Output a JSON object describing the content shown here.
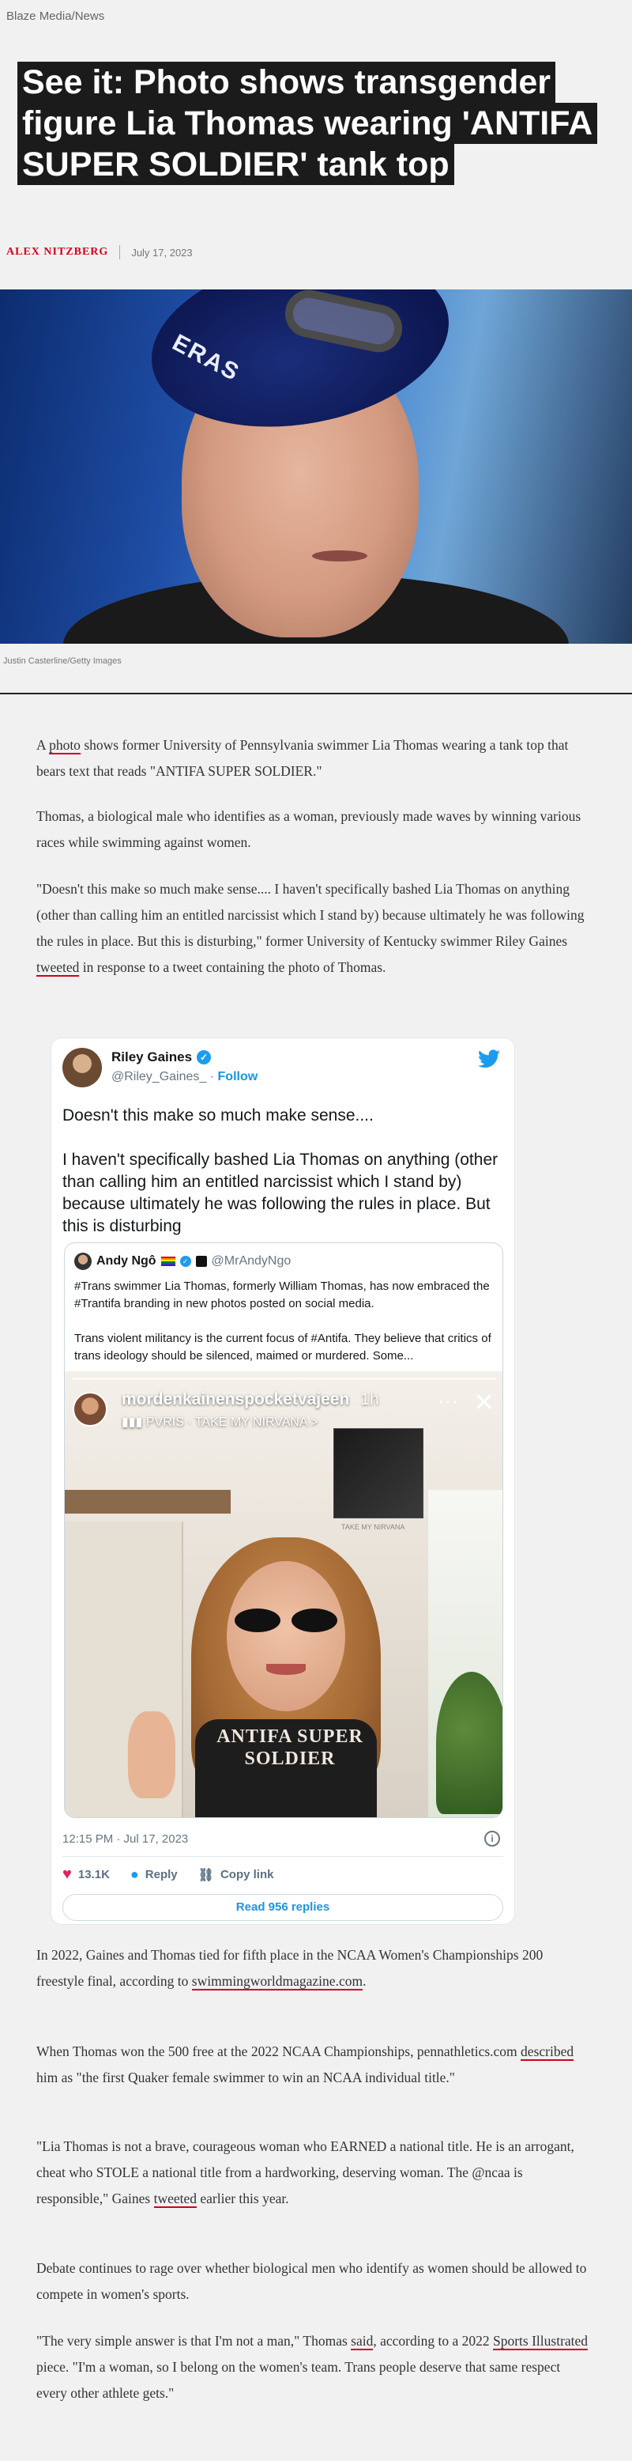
{
  "source": "Blaze Media/News",
  "headline": {
    "lines": [
      "See it: Photo shows transgender",
      "figure Lia Thomas wearing 'ANTIFA",
      "SUPER SOLDIER' tank top"
    ]
  },
  "byline": {
    "author": "Alex Nitzberg",
    "date": "July 17, 2023"
  },
  "hero": {
    "caption": "Justin Casterline/Getty Images",
    "cap_text": "ERAS"
  },
  "article": {
    "p1": {
      "link": "photo",
      "text": " shows former University of Pennsylvania swimmer Lia Thomas wearing a tank top that bears text that reads \"ANTIFA SUPER SOLDIER.\"",
      "pre": "A "
    },
    "p2": "Thomas, a biological male who identifies as a woman, previously made waves by winning various races while swimming against women.",
    "p3": {
      "pre": "\"Doesn't this make so much make sense.... I haven't specifically bashed Lia Thomas on anything (other than calling him an entitled narcissist which I stand by) because ultimately he was following the rules in place. But this is disturbing,\" former University of Kentucky swimmer Riley Gaines ",
      "link": "tweeted",
      "post": " in response to a tweet containing the photo of Thomas."
    },
    "p4": {
      "pre": "In 2022, Gaines and Thomas tied for fifth place in the NCAA Women's Championships 200 freestyle final, according to ",
      "link": "swimmingworldmagazine.com",
      "post": "."
    },
    "p5": {
      "pre": "When Thomas won the 500 free at the 2022 NCAA Championships, pennathletics.com ",
      "link": "described",
      "post": " him as \"the first Quaker female swimmer to win an NCAA individual title.\""
    },
    "p6": {
      "pre": "\"Lia Thomas is not a brave, courageous woman who EARNED a national title. He is an arrogant, cheat who STOLE a national title from a hardworking, deserving woman. The @ncaa is responsible,\" Gaines ",
      "link": "tweeted",
      "post": " earlier this year."
    },
    "p7": "Debate continues to rage over whether biological men who identify as women should be allowed to compete in women's sports.",
    "p8": {
      "pre": "\"The very simple answer is that I'm not a man,\" Thomas ",
      "link1": "said",
      "mid": ", according to a 2022 ",
      "link2": "Sports Illustrated",
      "post": " piece. \"I'm a woman, so I belong on the women's team. Trans people deserve that same respect every other athlete gets.\""
    }
  },
  "tweet": {
    "name": "Riley Gaines",
    "handle": "@Riley_Gaines_",
    "follow": "Follow",
    "separator": " · ",
    "text1": "Doesn't this make so much make sense....",
    "text2": "I haven't specifically bashed Lia Thomas on anything (other than calling him an entitled narcissist which I stand by) because ultimately he was following the rules in place. But this is disturbing",
    "quote": {
      "name": "Andy Ngô",
      "handle": "@MrAndyNgo",
      "text1": "#Trans swimmer Lia Thomas, formerly William Thomas, has now embraced the #Trantifa branding in new photos posted on social media.",
      "text2": "Trans violent militancy is the current focus of #Antifa. They believe that critics of trans ideology should be silenced, maimed or murdered. Some...",
      "story": {
        "user": "mordenkainenspocketvajeen",
        "time": "1h",
        "music": "PVRIS · TAKE MY NIRVANA >",
        "album_label": "TAKE MY NIRVANA",
        "shirt": "ANTIFA SUPER SOLDIER"
      }
    },
    "timestamp": "12:15 PM · Jul 17, 2023",
    "likes": "13.1K",
    "reply_label": "Reply",
    "copy_label": "Copy link",
    "replies_button": "Read 956 replies"
  }
}
